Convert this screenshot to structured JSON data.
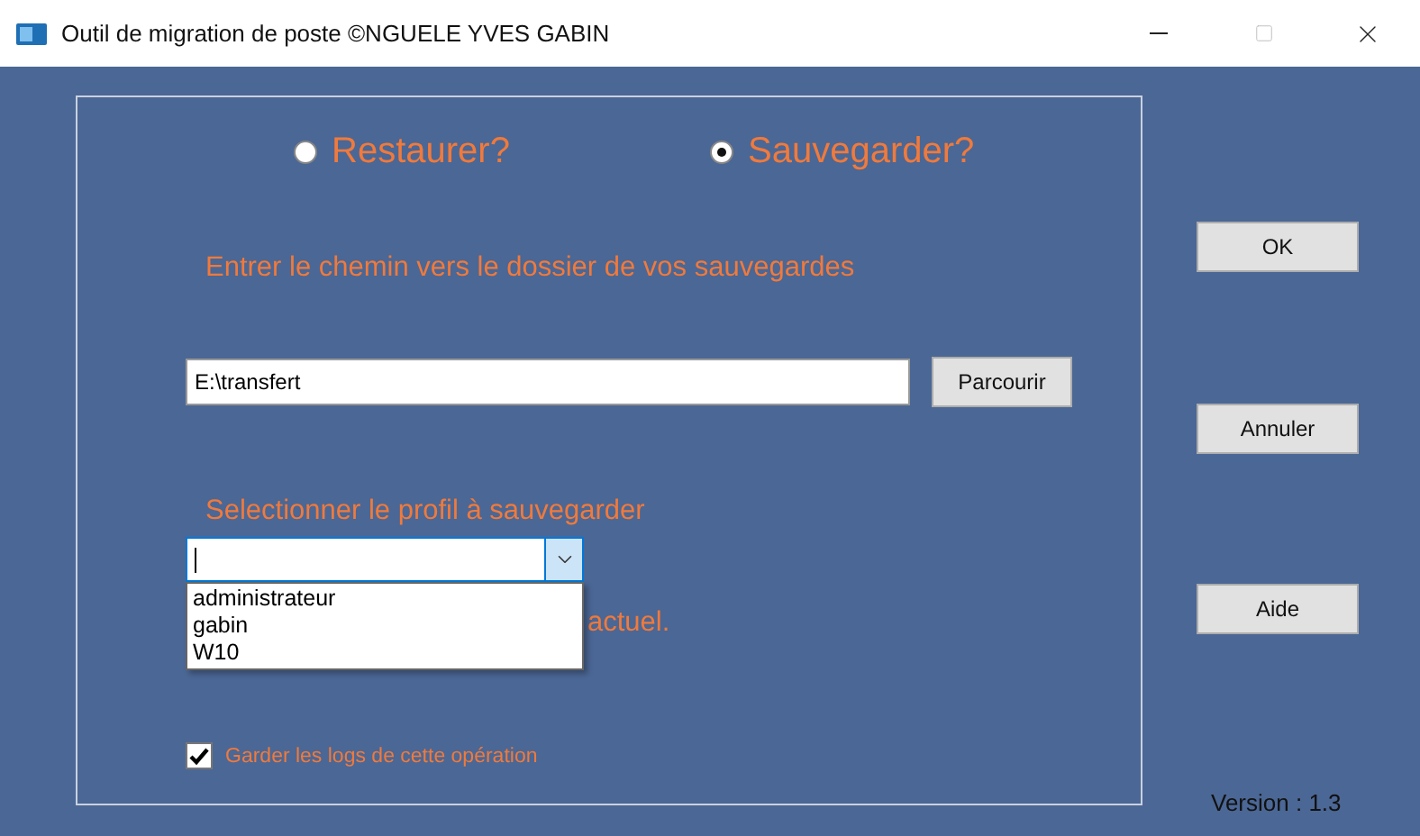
{
  "window": {
    "title": "Outil de migration de poste ©NGUELE YVES GABIN"
  },
  "modes": [
    {
      "label": "Restaurer?",
      "selected": false
    },
    {
      "label": "Sauvegarder?",
      "selected": true
    }
  ],
  "path_prompt": "Entrer le chemin vers le dossier de vos sauvegardes",
  "path_field": {
    "value": "E:\\transfert"
  },
  "browse_button": "Parcourir",
  "profile_prompt": "Selectionner le profil à sauvegarder",
  "profile_combo": {
    "expanded": true,
    "options": [
      "administrateur",
      "gabin",
      "W10"
    ]
  },
  "hidden_note": "actuel.",
  "keep_logs": {
    "label": "Garder les logs de cette opération",
    "checked": true
  },
  "buttons": [
    "OK",
    "Annuler",
    "Aide"
  ],
  "version": "Version : 1.3"
}
